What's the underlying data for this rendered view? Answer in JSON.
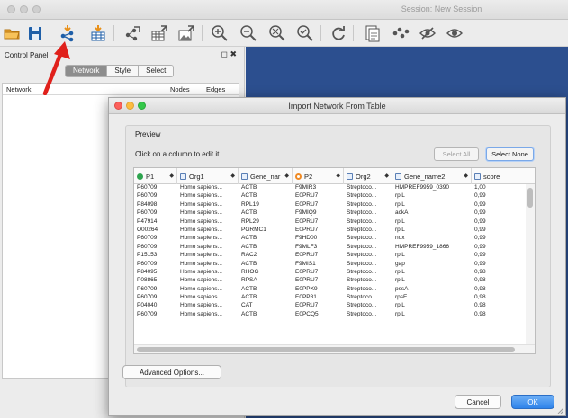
{
  "window": {
    "title": "Session: New Session"
  },
  "control_panel": {
    "title": "Control Panel",
    "icons": "◻ ✖",
    "tabs": [
      "Network",
      "Style",
      "Select"
    ],
    "active_tab": "Network",
    "columns": {
      "network": "Network",
      "nodes": "Nodes",
      "edges": "Edges"
    }
  },
  "toolbar": {
    "icons": [
      "open-folder-icon",
      "save-icon",
      "import-network-icon",
      "import-table-icon",
      "export-network-icon",
      "export-table-icon",
      "export-image-icon",
      "zoom-in-icon",
      "zoom-out-icon",
      "zoom-fit-icon",
      "zoom-selected-icon",
      "refresh-icon",
      "new-network-icon",
      "show-all-icon",
      "hide-icon",
      "show-icon"
    ]
  },
  "colors": {
    "canvas": "#2c4f8f",
    "ok": "#2f83ea",
    "annotation_arrow": "#e0201b"
  },
  "dialog": {
    "title": "Import Network From Table",
    "preview_label": "Preview",
    "hint": "Click on a column to edit it.",
    "select_all": "Select All",
    "select_none": "Select None",
    "advanced": "Advanced Options...",
    "cancel": "Cancel",
    "ok": "OK",
    "columns": [
      {
        "label": "P1",
        "icon": "source-node-icon"
      },
      {
        "label": "Org1",
        "icon": "attribute-icon"
      },
      {
        "label": "Gene_nar",
        "icon": "attribute-icon"
      },
      {
        "label": "P2",
        "icon": "target-node-icon"
      },
      {
        "label": "Org2",
        "icon": "attribute-icon"
      },
      {
        "label": "Gene_name2",
        "icon": "attribute-icon"
      },
      {
        "label": "score",
        "icon": "attribute-icon"
      }
    ],
    "rows": [
      [
        "P60709",
        "Homo sapiens...",
        "ACTB",
        "F9MIR3",
        "Streptoco...",
        "HMPREF9959_0390",
        "1,00"
      ],
      [
        "P60709",
        "Homo sapiens...",
        "ACTB",
        "E0PRU7",
        "Streptoco...",
        "rplL",
        "0,99"
      ],
      [
        "P84098",
        "Homo sapiens...",
        "RPL19",
        "E0PRU7",
        "Streptoco...",
        "rplL",
        "0,99"
      ],
      [
        "P60709",
        "Homo sapiens...",
        "ACTB",
        "F9MIQ9",
        "Streptoco...",
        "ackA",
        "0,99"
      ],
      [
        "P47914",
        "Homo sapiens...",
        "RPL29",
        "E0PRU7",
        "Streptoco...",
        "rplL",
        "0,99"
      ],
      [
        "O00264",
        "Homo sapiens...",
        "PGRMC1",
        "E0PRU7",
        "Streptoco...",
        "rplL",
        "0,99"
      ],
      [
        "P60709",
        "Homo sapiens...",
        "ACTB",
        "F9HD00",
        "Streptoco...",
        "nox",
        "0,99"
      ],
      [
        "P60709",
        "Homo sapiens...",
        "ACTB",
        "F9MLF3",
        "Streptoco...",
        "HMPREF9959_1866",
        "0,99"
      ],
      [
        "P15153",
        "Homo sapiens...",
        "RAC2",
        "E0PRU7",
        "Streptoco...",
        "rplL",
        "0,99"
      ],
      [
        "P60709",
        "Homo sapiens...",
        "ACTB",
        "F9MIS1",
        "Streptoco...",
        "gap",
        "0,99"
      ],
      [
        "P84095",
        "Homo sapiens...",
        "RHOG",
        "E0PRU7",
        "Streptoco...",
        "rplL",
        "0,98"
      ],
      [
        "P08865",
        "Homo sapiens...",
        "RPSA",
        "E0PRU7",
        "Streptoco...",
        "rplL",
        "0,98"
      ],
      [
        "P60709",
        "Homo sapiens...",
        "ACTB",
        "E0PPX9",
        "Streptoco...",
        "pssA",
        "0,98"
      ],
      [
        "P60709",
        "Homo sapiens...",
        "ACTB",
        "E0PP81",
        "Streptoco...",
        "rpsE",
        "0,98"
      ],
      [
        "P04040",
        "Homo sapiens...",
        "CAT",
        "E0PRU7",
        "Streptoco...",
        "rplL",
        "0,98"
      ],
      [
        "P60709",
        "Homo sapiens...",
        "ACTB",
        "E0PCQ5",
        "Streptoco...",
        "rplL",
        "0,98"
      ]
    ]
  }
}
